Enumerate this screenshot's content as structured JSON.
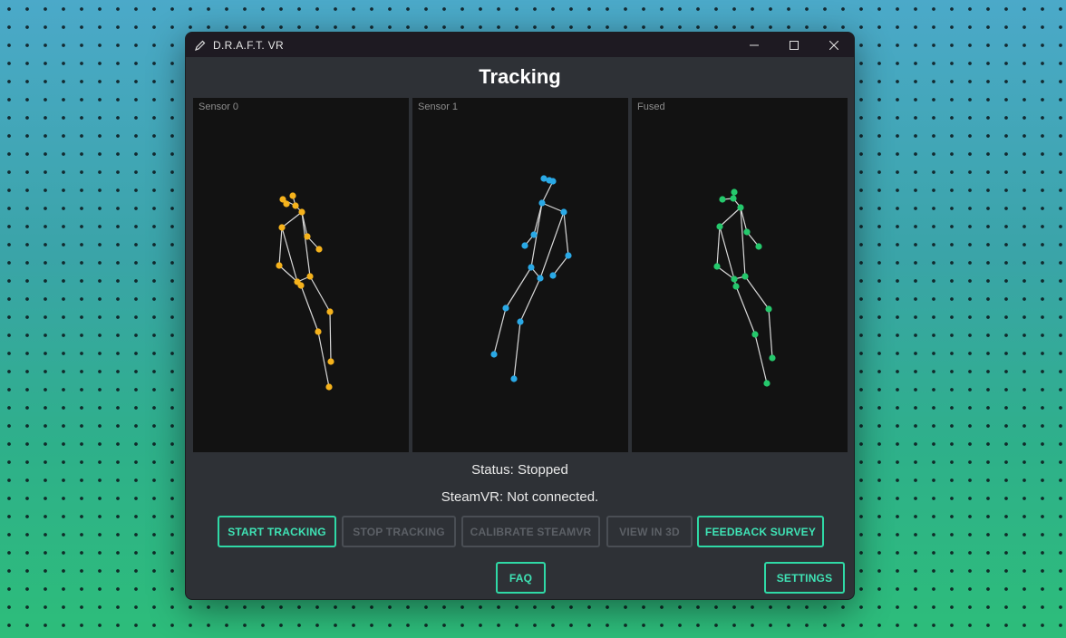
{
  "window": {
    "title": "D.R.A.F.T. VR"
  },
  "page": {
    "title": "Tracking"
  },
  "panels": [
    {
      "label": "Sensor 0",
      "color": "#f5b21c"
    },
    {
      "label": "Sensor 1",
      "color": "#2aa9e6"
    },
    {
      "label": "Fused",
      "color": "#25c86c"
    }
  ],
  "status": {
    "tracking": "Status: Stopped",
    "steamvr": "SteamVR: Not connected."
  },
  "buttons": {
    "start_tracking": "START TRACKING",
    "stop_tracking": "STOP TRACKING",
    "calibrate_steamvr": "CALIBRATE STEAMVR",
    "view_in_3d": "VIEW IN 3D",
    "feedback_survey": "FEEDBACK SURVEY",
    "faq": "FAQ",
    "settings": "SETTINGS"
  },
  "button_states": {
    "start_tracking": "enabled",
    "stop_tracking": "disabled",
    "calibrate_steamvr": "disabled",
    "view_in_3d": "disabled",
    "feedback_survey": "enabled",
    "faq": "enabled",
    "settings": "enabled"
  },
  "colors": {
    "accent": "#2fd9a6",
    "bone": "#d9d9d9"
  }
}
